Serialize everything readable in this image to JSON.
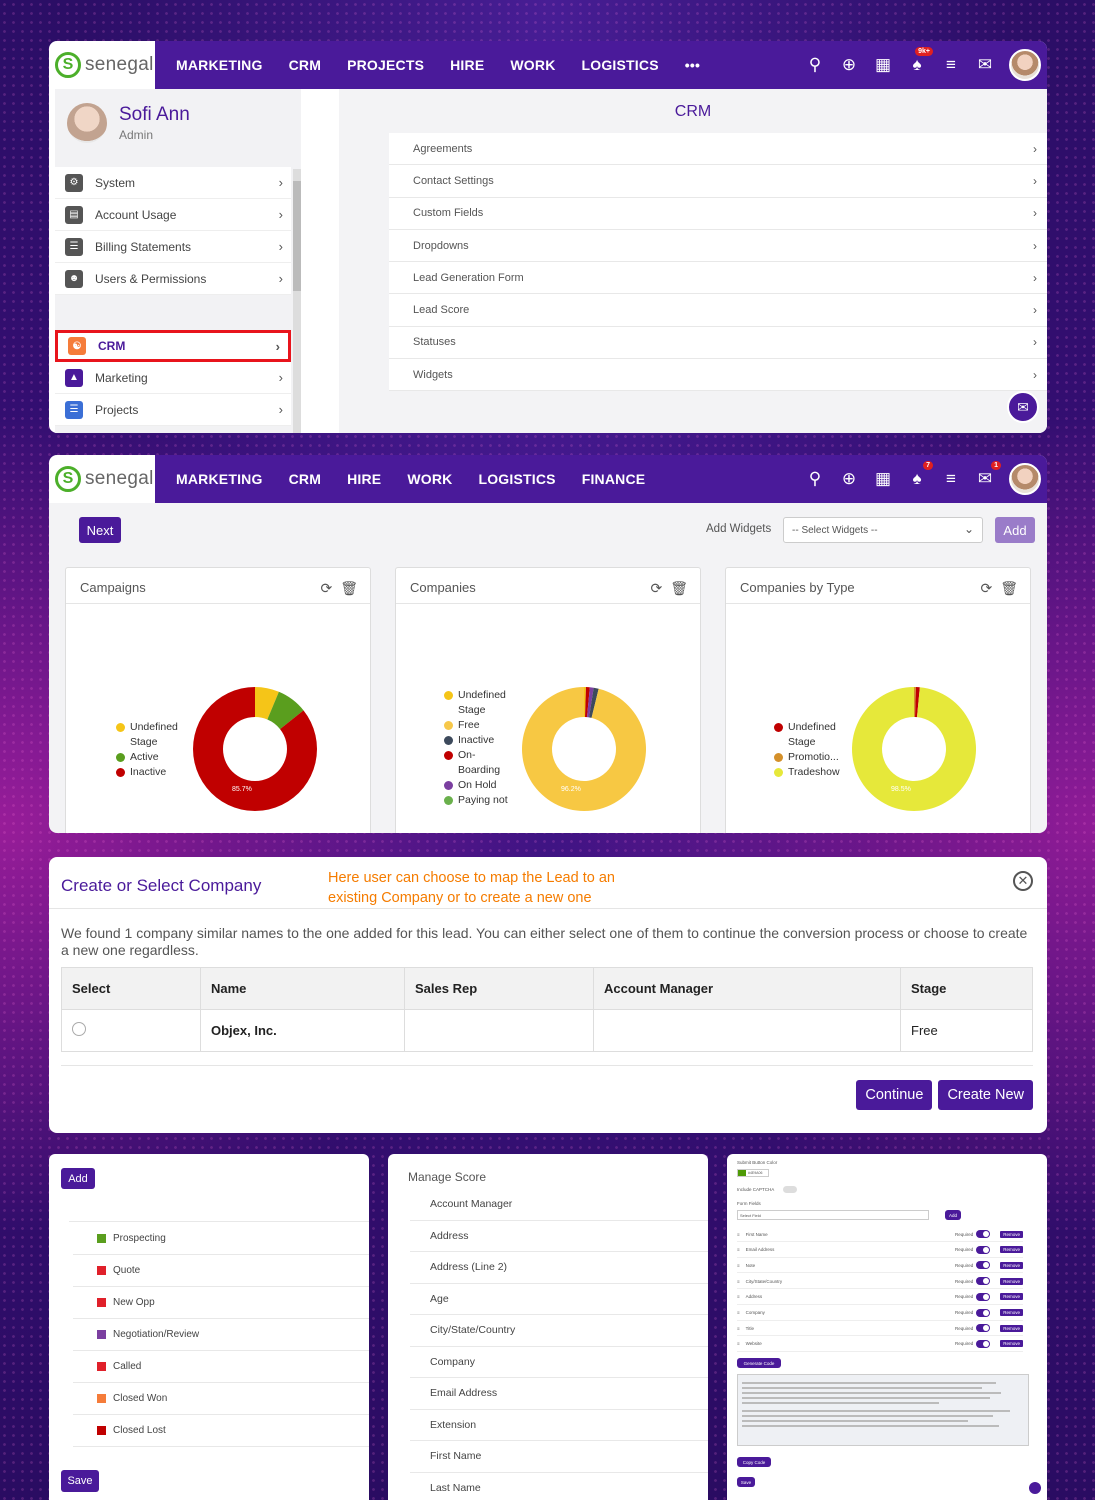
{
  "nav1": {
    "logo": "senegal",
    "menu": [
      "MARKETING",
      "CRM",
      "PROJECTS",
      "HIRE",
      "WORK",
      "LOGISTICS",
      "•••"
    ],
    "badge": "9k+"
  },
  "profile": {
    "name": "Sofi Ann",
    "role": "Admin"
  },
  "sidebar": {
    "items": [
      {
        "label": "System",
        "icon": "gear-icon",
        "color": "#555555"
      },
      {
        "label": "Account Usage",
        "icon": "chart-icon",
        "color": "#555555"
      },
      {
        "label": "Billing Statements",
        "icon": "sliders-icon",
        "color": "#555555"
      },
      {
        "label": "Users & Permissions",
        "icon": "users-icon",
        "color": "#555555"
      },
      {
        "label": "CRM",
        "icon": "handshake-icon",
        "color": "#f57c3a"
      },
      {
        "label": "Marketing",
        "icon": "megaphone-icon",
        "color": "#4a1a9a"
      },
      {
        "label": "Projects",
        "icon": "list-icon",
        "color": "#3b6fd6"
      }
    ]
  },
  "crm": {
    "title": "CRM",
    "items": [
      "Agreements",
      "Contact Settings",
      "Custom Fields",
      "Dropdowns",
      "Lead Generation Form",
      "Lead Score",
      "Statuses",
      "Widgets"
    ]
  },
  "nav2": {
    "logo": "senegal",
    "menu": [
      "MARKETING",
      "CRM",
      "HIRE",
      "WORK",
      "LOGISTICS",
      "FINANCE"
    ],
    "badge_notif": "7",
    "badge_chat": "1"
  },
  "dashboard": {
    "next_label": "Next",
    "add_widgets_label": "Add Widgets",
    "select_placeholder": "-- Select Widgets --",
    "add_label": "Add",
    "widgets": [
      {
        "title": "Campaigns",
        "legend": [
          {
            "label": "Undefined Stage",
            "color": "#f5c518"
          },
          {
            "label": "Active",
            "color": "#5a9e1e"
          },
          {
            "label": "Inactive",
            "color": "#c00000"
          }
        ],
        "slices": [
          {
            "label": "Undefined Stage",
            "value": 6.3,
            "color": "#f5c518"
          },
          {
            "label": "Active",
            "value": 8.0,
            "color": "#5a9e1e"
          },
          {
            "label": "Inactive",
            "value": 85.7,
            "color": "#c00000"
          }
        ],
        "center_label": "85.7%"
      },
      {
        "title": "Companies",
        "legend": [
          {
            "label": "Undefined Stage",
            "color": "#f5c518"
          },
          {
            "label": "Free",
            "color": "#f7c84a"
          },
          {
            "label": "Inactive",
            "color": "#3d4a5c"
          },
          {
            "label": "On-Boarding",
            "color": "#c00000"
          },
          {
            "label": "On Hold",
            "color": "#7b3fa0"
          },
          {
            "label": "Paying not",
            "color": "#6ab04c"
          }
        ],
        "slices": [
          {
            "label": "Free",
            "value": 96.2,
            "color": "#f7c843"
          },
          {
            "label": "Inactive",
            "value": 1.3,
            "color": "#3d4a5c"
          },
          {
            "label": "On-Boarding",
            "value": 1.0,
            "color": "#c00000"
          },
          {
            "label": "On Hold",
            "value": 1.0,
            "color": "#7b3fa0"
          },
          {
            "label": "Undefined Stage",
            "value": 0.5,
            "color": "#f5c518"
          }
        ],
        "center_label": "96.2%"
      },
      {
        "title": "Companies by Type",
        "legend": [
          {
            "label": "Undefined Stage",
            "color": "#c00000"
          },
          {
            "label": "Promotio...",
            "color": "#d4902a"
          },
          {
            "label": "Tradeshow",
            "color": "#e6e83a"
          }
        ],
        "slices": [
          {
            "label": "Tradeshow",
            "value": 98.5,
            "color": "#e6e83a"
          },
          {
            "label": "Undefined Stage",
            "value": 1.0,
            "color": "#c00000"
          },
          {
            "label": "Promotio...",
            "value": 0.5,
            "color": "#d4902a"
          }
        ],
        "center_label": "98.5%"
      }
    ]
  },
  "modal": {
    "title": "Create or Select Company",
    "note": "Here user can choose to map the Lead to an existing Company or to create a new one",
    "text": "We found 1 company similar names to the one added for this lead. You can either select one of them to continue the conversion process or choose to create a new one regardless.",
    "headers": [
      "Select",
      "Name",
      "Sales Rep",
      "Account Manager",
      "Stage"
    ],
    "row": {
      "name": "Objex, Inc.",
      "sales_rep": "",
      "account_manager": "",
      "stage": "Free"
    },
    "continue_label": "Continue",
    "create_label": "Create New"
  },
  "statuses": {
    "add_label": "Add",
    "save_label": "Save",
    "items": [
      {
        "label": "Prospecting",
        "color": "#5a9e1e"
      },
      {
        "label": "Quote",
        "color": "#e0202a"
      },
      {
        "label": "New Opp",
        "color": "#e0202a"
      },
      {
        "label": "Negotiation/Review",
        "color": "#7b3fa0"
      },
      {
        "label": "Called",
        "color": "#e0202a"
      },
      {
        "label": "Closed Won",
        "color": "#f57c3a"
      },
      {
        "label": "Closed Lost",
        "color": "#c00000"
      }
    ]
  },
  "manage_score": {
    "title": "Manage Score",
    "items": [
      "Account Manager",
      "Address",
      "Address (Line 2)",
      "Age",
      "City/State/Country",
      "Company",
      "Email Address",
      "Extension",
      "First Name",
      "Last Name"
    ]
  },
  "form_builder": {
    "submit_color_label": "Submit Button Color",
    "submit_color_value": "#4E9A06",
    "captcha_label": "Include CAPTCHA",
    "form_fields_label": "Form Fields",
    "select_field": "Select Field",
    "add_label": "Add",
    "fields": [
      "First Name",
      "Email Address",
      "Note",
      "City/State/Country",
      "Address",
      "Company",
      "Title",
      "Website"
    ],
    "required_label": "Required",
    "remove_label": "Remove",
    "generate_label": "Generate Code",
    "copy_label": "Copy Code",
    "save_label": "Save"
  }
}
